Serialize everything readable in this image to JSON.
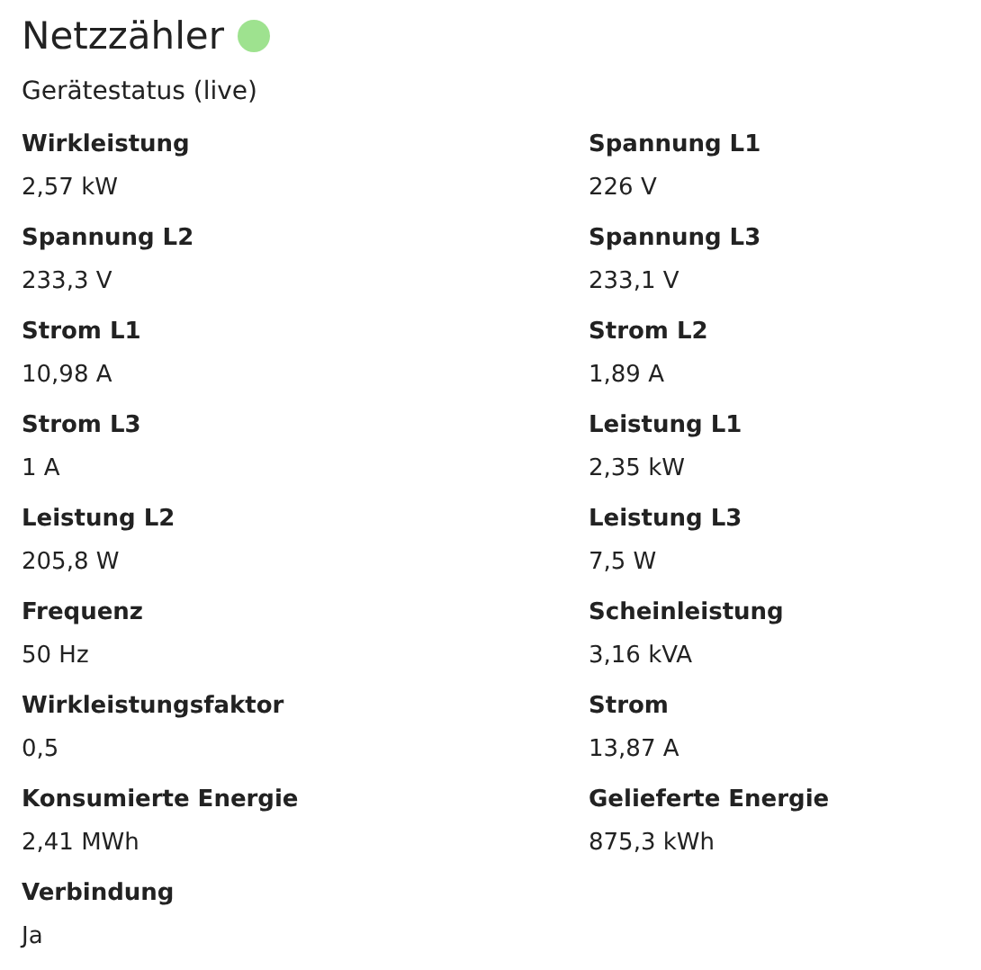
{
  "title": "Netzzähler",
  "status": {
    "color": "#9ee28f"
  },
  "subtitle": "Gerätestatus (live)",
  "fields": [
    {
      "label": "Wirkleistung",
      "value": "2,57 kW"
    },
    {
      "label": "Spannung L1",
      "value": "226 V"
    },
    {
      "label": "Spannung L2",
      "value": "233,3 V"
    },
    {
      "label": "Spannung L3",
      "value": "233,1 V"
    },
    {
      "label": "Strom L1",
      "value": "10,98 A"
    },
    {
      "label": "Strom L2",
      "value": "1,89 A"
    },
    {
      "label": "Strom L3",
      "value": "1 A"
    },
    {
      "label": "Leistung L1",
      "value": "2,35 kW"
    },
    {
      "label": "Leistung L2",
      "value": "205,8 W"
    },
    {
      "label": "Leistung L3",
      "value": "7,5 W"
    },
    {
      "label": "Frequenz",
      "value": "50 Hz"
    },
    {
      "label": "Scheinleistung",
      "value": "3,16 kVA"
    },
    {
      "label": "Wirkleistungsfaktor",
      "value": "0,5"
    },
    {
      "label": "Strom",
      "value": "13,87 A"
    },
    {
      "label": "Konsumierte Energie",
      "value": "2,41 MWh"
    },
    {
      "label": "Gelieferte Energie",
      "value": "875,3 kWh"
    },
    {
      "label": "Verbindung",
      "value": "Ja"
    }
  ]
}
